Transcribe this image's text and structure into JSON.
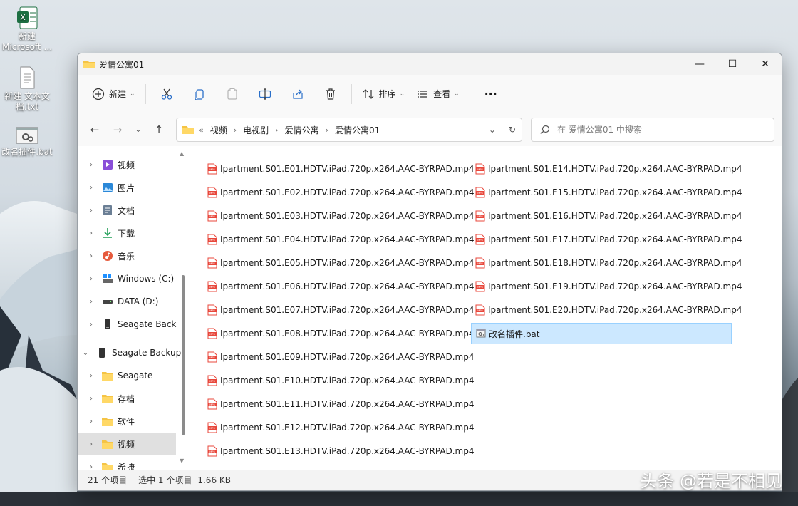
{
  "desktop": {
    "icons": [
      {
        "label": "新建\nMicrosoft ...",
        "icon": "excel-icon"
      },
      {
        "label": "新建 文本文档.txt",
        "icon": "text-file-icon"
      },
      {
        "label": "改名插件.bat",
        "icon": "bat-file-icon"
      }
    ]
  },
  "window": {
    "title": "爱情公寓01",
    "controls": {
      "minimize": "—",
      "maximize": "☐",
      "close": "✕"
    }
  },
  "command_bar": {
    "new_label": "新建",
    "sort_label": "排序",
    "view_label": "查看",
    "more_label": "···"
  },
  "navigation": {
    "back": "←",
    "forward": "→",
    "recent": "⌄",
    "up": "↑",
    "overflow": "«",
    "breadcrumbs": [
      "视频",
      "电视剧",
      "爱情公寓",
      "爱情公寓01"
    ],
    "search_placeholder": "在 爱情公寓01 中搜索"
  },
  "sidebar": {
    "items": [
      {
        "label": "视频",
        "icon": "video-icon",
        "expander": ">"
      },
      {
        "label": "图片",
        "icon": "picture-icon",
        "expander": ">"
      },
      {
        "label": "文档",
        "icon": "document-icon",
        "expander": ">"
      },
      {
        "label": "下载",
        "icon": "download-icon",
        "expander": ">"
      },
      {
        "label": "音乐",
        "icon": "music-icon",
        "expander": ">"
      },
      {
        "label": "Windows (C:)",
        "icon": "drive-c-icon",
        "expander": ">"
      },
      {
        "label": "DATA (D:)",
        "icon": "drive-d-icon",
        "expander": ">"
      },
      {
        "label": "Seagate Back",
        "icon": "external-drive-icon",
        "expander": ">"
      },
      {
        "label": "Seagate Backup",
        "icon": "external-drive-icon",
        "expander": "v"
      },
      {
        "label": "Seagate",
        "icon": "folder-icon",
        "expander": ">"
      },
      {
        "label": "存档",
        "icon": "folder-icon",
        "expander": ">"
      },
      {
        "label": "软件",
        "icon": "folder-icon",
        "expander": ">"
      },
      {
        "label": "视频",
        "icon": "folder-icon",
        "expander": ">"
      },
      {
        "label": "希捷",
        "icon": "folder-icon",
        "expander": ">"
      }
    ]
  },
  "files": {
    "column1": [
      "Ipartment.S01.E01.HDTV.iPad.720p.x264.AAC-BYRPAD.mp4",
      "Ipartment.S01.E02.HDTV.iPad.720p.x264.AAC-BYRPAD.mp4",
      "Ipartment.S01.E03.HDTV.iPad.720p.x264.AAC-BYRPAD.mp4",
      "Ipartment.S01.E04.HDTV.iPad.720p.x264.AAC-BYRPAD.mp4",
      "Ipartment.S01.E05.HDTV.iPad.720p.x264.AAC-BYRPAD.mp4",
      "Ipartment.S01.E06.HDTV.iPad.720p.x264.AAC-BYRPAD.mp4",
      "Ipartment.S01.E07.HDTV.iPad.720p.x264.AAC-BYRPAD.mp4",
      "Ipartment.S01.E08.HDTV.iPad.720p.x264.AAC-BYRPAD.mp4",
      "Ipartment.S01.E09.HDTV.iPad.720p.x264.AAC-BYRPAD.mp4",
      "Ipartment.S01.E10.HDTV.iPad.720p.x264.AAC-BYRPAD.mp4",
      "Ipartment.S01.E11.HDTV.iPad.720p.x264.AAC-BYRPAD.mp4",
      "Ipartment.S01.E12.HDTV.iPad.720p.x264.AAC-BYRPAD.mp4",
      "Ipartment.S01.E13.HDTV.iPad.720p.x264.AAC-BYRPAD.mp4"
    ],
    "column2": [
      "Ipartment.S01.E14.HDTV.iPad.720p.x264.AAC-BYRPAD.mp4",
      "Ipartment.S01.E15.HDTV.iPad.720p.x264.AAC-BYRPAD.mp4",
      "Ipartment.S01.E16.HDTV.iPad.720p.x264.AAC-BYRPAD.mp4",
      "Ipartment.S01.E17.HDTV.iPad.720p.x264.AAC-BYRPAD.mp4",
      "Ipartment.S01.E18.HDTV.iPad.720p.x264.AAC-BYRPAD.mp4",
      "Ipartment.S01.E19.HDTV.iPad.720p.x264.AAC-BYRPAD.mp4",
      "Ipartment.S01.E20.HDTV.iPad.720p.x264.AAC-BYRPAD.mp4",
      "改名插件.bat"
    ],
    "selected": "改名插件.bat"
  },
  "status_bar": {
    "item_count": "21 个项目",
    "selection": "选中 1 个项目",
    "size": "1.66 KB"
  },
  "watermark": "头条 @若是不相见",
  "colors": {
    "accent": "#0067c0",
    "selection_bg": "#cce8ff",
    "selection_border": "#99d1ff",
    "mp4_icon": "#e8473b",
    "folder": "#f5c445"
  }
}
